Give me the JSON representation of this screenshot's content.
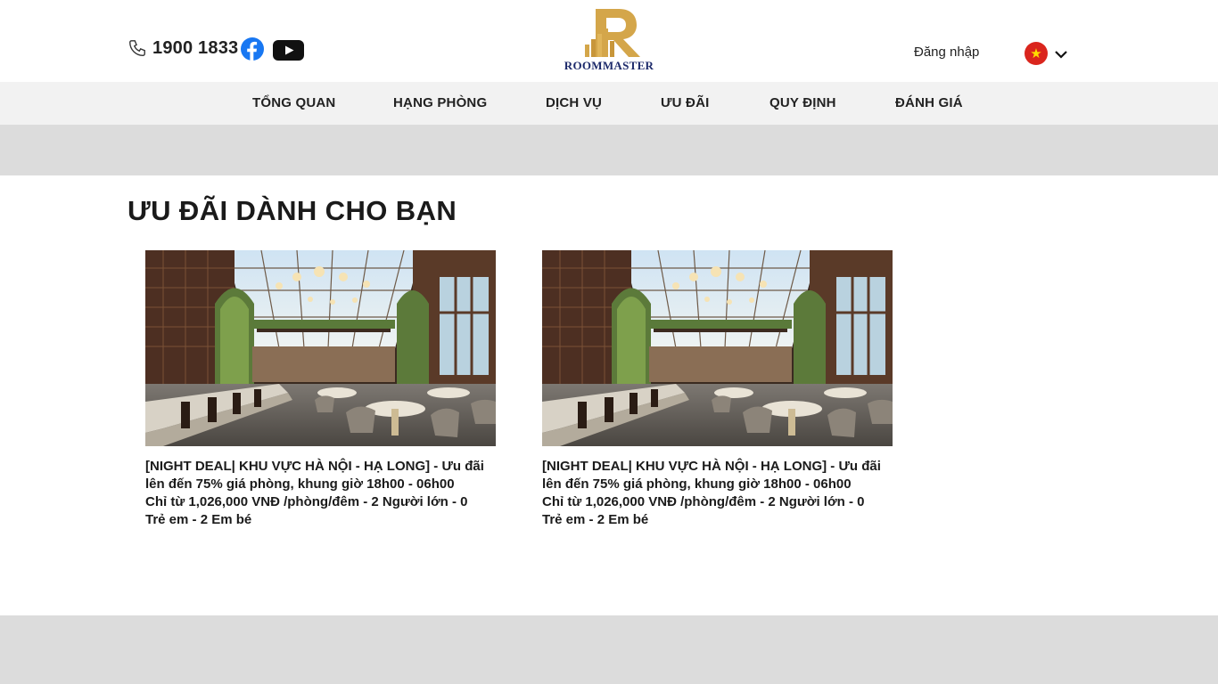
{
  "header": {
    "phone": "1900 1833",
    "logo_text": "ROOMMASTER",
    "login_label": "Đăng nhập",
    "language": "vi",
    "icons": [
      "phone-icon",
      "facebook-icon",
      "youtube-icon",
      "vietnam-flag-icon",
      "chevron-down-icon"
    ],
    "colors": {
      "facebook": "#1877f2",
      "logo_gold": "#d4a64a",
      "logo_navy": "#1d2a6b",
      "flag_red": "#da251d",
      "flag_star": "#ffde00"
    }
  },
  "nav": {
    "items": [
      {
        "label": "TỔNG QUAN"
      },
      {
        "label": "HẠNG PHÒNG"
      },
      {
        "label": "DỊCH VỤ"
      },
      {
        "label": "ƯU ĐÃI"
      },
      {
        "label": "QUY ĐỊNH"
      },
      {
        "label": "ĐÁNH GIÁ"
      }
    ]
  },
  "offers": {
    "title": "ƯU ĐÃI DÀNH CHO BẠN",
    "cards": [
      {
        "lines": [
          "[NIGHT DEAL| KHU VỰC HÀ NỘI - HẠ LONG] - Ưu đãi",
          "lên đến 75% giá phòng, khung giờ 18h00 - 06h00",
          "Chỉ từ 1,026,000 VNĐ /phòng/đêm - 2 Người lớn - 0",
          "Trẻ em - 2 Em bé"
        ]
      },
      {
        "lines": [
          "[NIGHT DEAL| KHU VỰC HÀ NỘI - HẠ LONG] - Ưu đãi",
          "lên đến 75% giá phòng, khung giờ 18h00 - 06h00",
          "Chỉ từ 1,026,000 VNĐ /phòng/đêm - 2 Người lớn - 0",
          "Trẻ em - 2 Em bé"
        ]
      }
    ]
  }
}
